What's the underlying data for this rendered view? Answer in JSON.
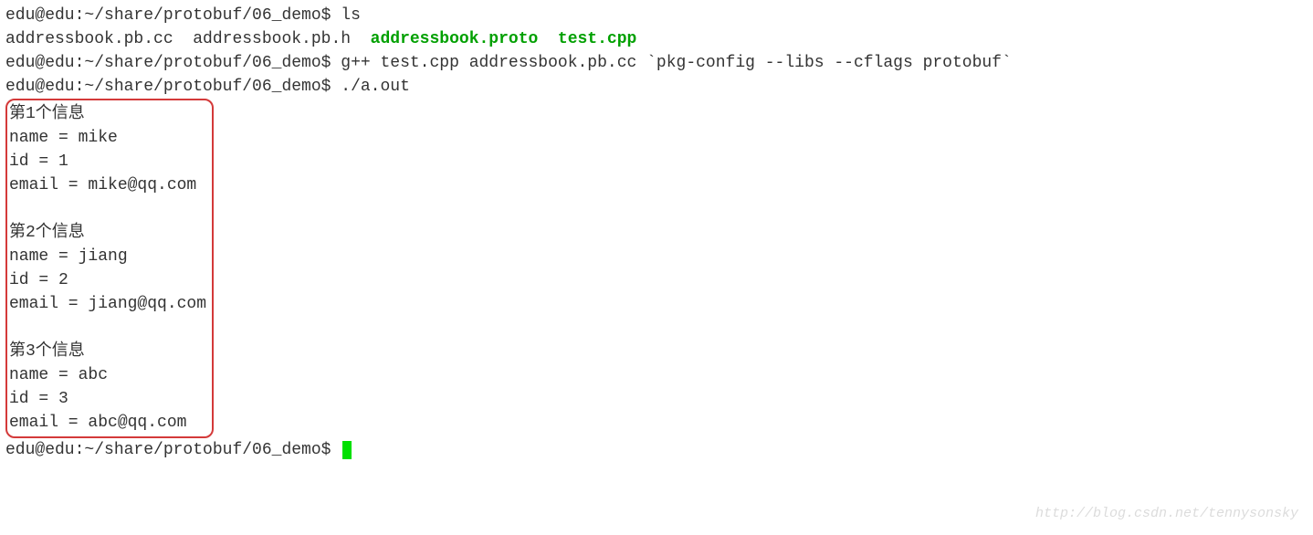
{
  "prompt": "edu@edu:~/share/protobuf/06_demo$ ",
  "commands": {
    "ls": "ls",
    "gpp": "g++ test.cpp addressbook.pb.cc `pkg-config --libs --cflags protobuf`",
    "run": "./a.out"
  },
  "ls_output": {
    "f1": "addressbook.pb.cc  ",
    "f2": "addressbook.pb.h  ",
    "f3": "addressbook.proto  ",
    "f4": "test.cpp"
  },
  "output": {
    "records": [
      {
        "header": "第1个信息",
        "name": "name = mike",
        "id": "id = 1",
        "email": "email = mike@qq.com"
      },
      {
        "header": "第2个信息",
        "name": "name = jiang",
        "id": "id = 2",
        "email": "email = jiang@qq.com"
      },
      {
        "header": "第3个信息",
        "name": "name = abc",
        "id": "id = 3",
        "email": "email = abc@qq.com"
      }
    ]
  },
  "watermark": "http://blog.csdn.net/tennysonsky"
}
